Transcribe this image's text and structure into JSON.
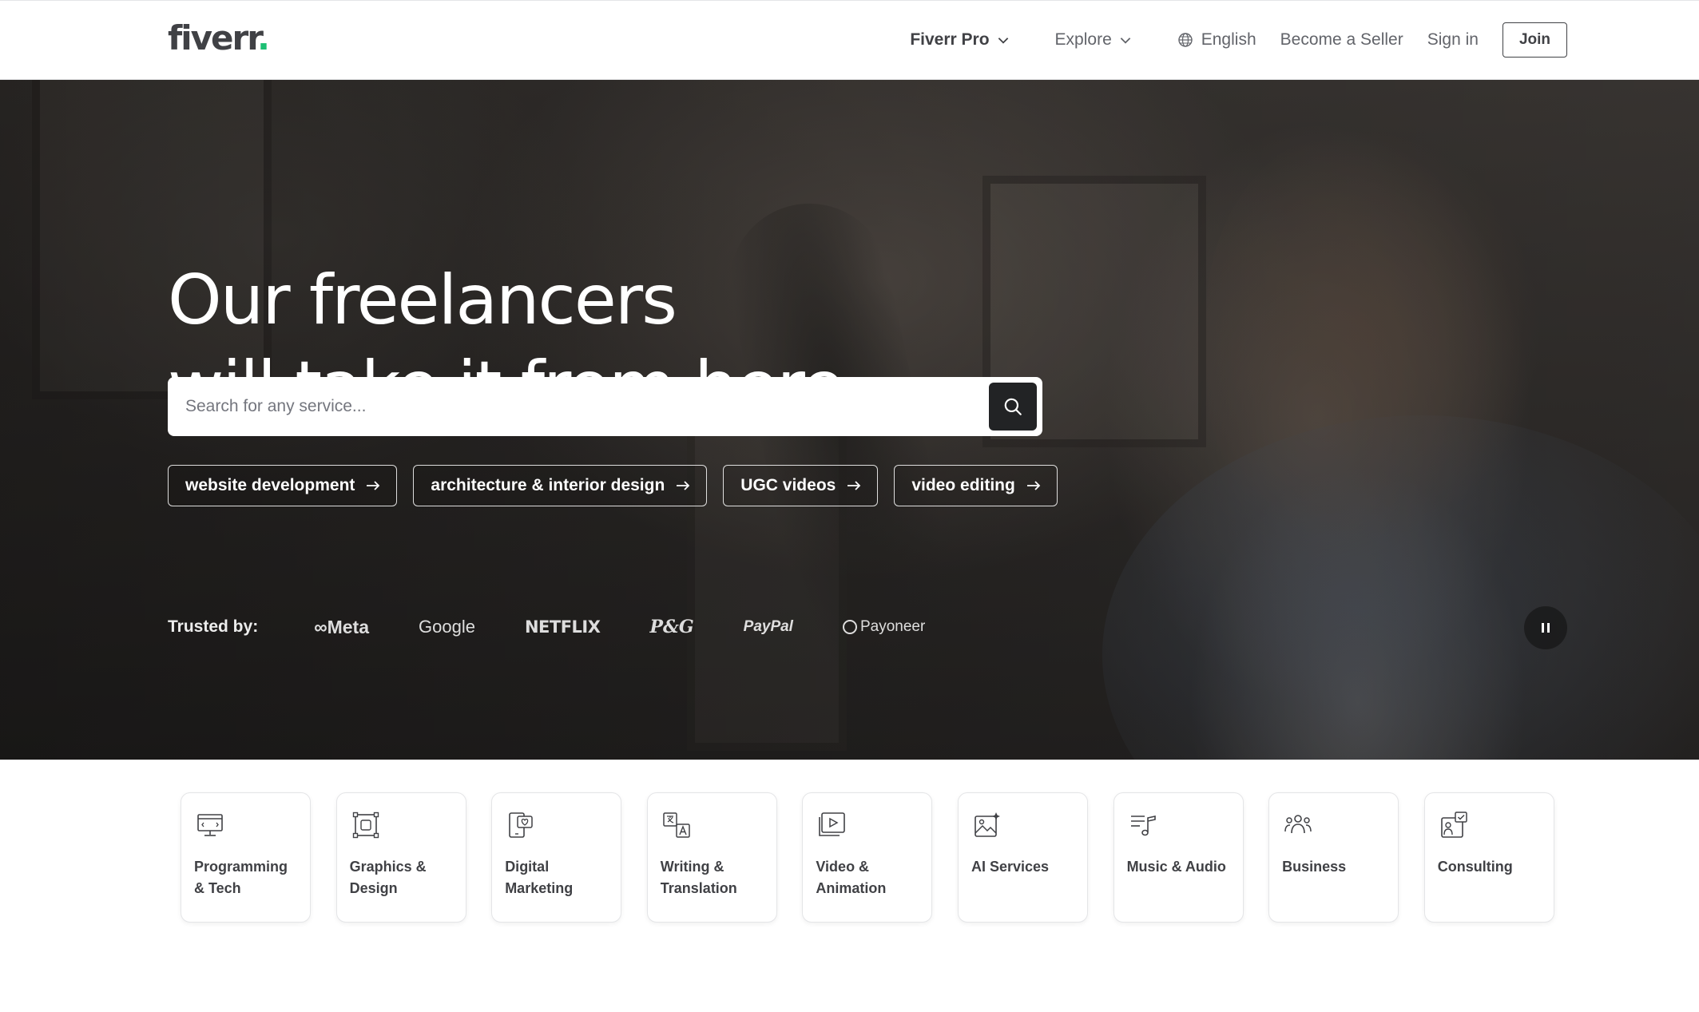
{
  "header": {
    "logo": "fiverr",
    "logo_dot": ".",
    "nav": {
      "fiverr_pro": "Fiverr Pro",
      "explore": "Explore",
      "language": "English",
      "become_seller": "Become a Seller",
      "sign_in": "Sign in",
      "join": "Join"
    }
  },
  "hero": {
    "title_line1": "Our freelancers",
    "title_line2": "will take it from here",
    "search": {
      "placeholder": "Search for any service..."
    },
    "chips": [
      "website development",
      "architecture & interior design",
      "UGC videos",
      "video editing"
    ],
    "trusted": {
      "label": "Trusted by:",
      "brands": [
        "Meta",
        "Google",
        "NETFLIX",
        "P&G",
        "PayPal",
        "Payoneer"
      ]
    }
  },
  "categories": [
    {
      "label": "Programming & Tech",
      "icon": "monitor-code-icon"
    },
    {
      "label": "Graphics & Design",
      "icon": "design-frame-icon"
    },
    {
      "label": "Digital Marketing",
      "icon": "phone-heart-icon"
    },
    {
      "label": "Writing & Translation",
      "icon": "translate-icon"
    },
    {
      "label": "Video & Animation",
      "icon": "video-play-icon"
    },
    {
      "label": "AI Services",
      "icon": "ai-image-icon"
    },
    {
      "label": "Music & Audio",
      "icon": "music-note-icon"
    },
    {
      "label": "Business",
      "icon": "people-group-icon"
    },
    {
      "label": "Consulting",
      "icon": "consulting-chart-icon"
    }
  ],
  "colors": {
    "brand_green": "#1dbf73",
    "text_dark": "#404145",
    "search_button": "#222325"
  }
}
